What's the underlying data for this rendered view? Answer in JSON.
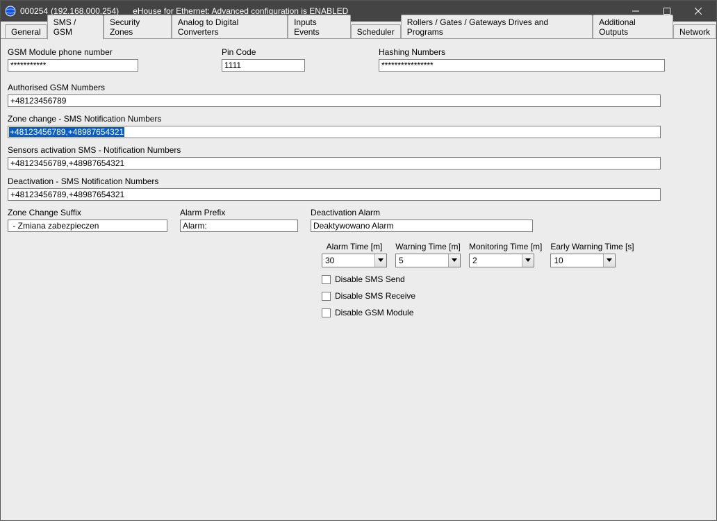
{
  "titlebar": {
    "device_id": "000254",
    "ip": "(192.168.000.254)",
    "app_title": "eHouse for Ethernet: Advanced configuration is ENABLED"
  },
  "tabs": [
    "General",
    "SMS / GSM",
    "Security Zones",
    "Analog to Digital Converters",
    "Inputs Events",
    "Scheduler",
    "Rollers / Gates / Gateways Drives  and Programs",
    "Additional Outputs",
    "Network"
  ],
  "active_tab_index": 1,
  "fields": {
    "gsm_phone": {
      "label": "GSM Module phone number",
      "value": "***********"
    },
    "pin": {
      "label": "Pin Code",
      "value": "1111"
    },
    "hashing": {
      "label": "Hashing Numbers",
      "value": "****************"
    },
    "authorised": {
      "label": "Authorised GSM Numbers",
      "value": "+48123456789"
    },
    "zone_change_nums": {
      "label": "Zone change - SMS Notification Numbers",
      "value": "+48123456789,+48987654321"
    },
    "sensors_nums": {
      "label": "Sensors activation SMS - Notification Numbers",
      "value": "+48123456789,+48987654321"
    },
    "deact_nums": {
      "label": "Deactivation - SMS Notification Numbers",
      "value": "+48123456789,+48987654321"
    },
    "zone_suffix": {
      "label": "Zone Change Suffix",
      "value": " - Zmiana zabezpieczen"
    },
    "alarm_prefix": {
      "label": "Alarm Prefix",
      "value": "Alarm:"
    },
    "deact_alarm": {
      "label": "Deactivation Alarm",
      "value": "Deaktywowano Alarm"
    }
  },
  "dropdowns": {
    "alarm_time": {
      "label": "Alarm Time [m]",
      "value": "30"
    },
    "warning_time": {
      "label": "Warning Time [m]",
      "value": "5"
    },
    "monitoring_time": {
      "label": "Monitoring Time [m]",
      "value": "2"
    },
    "early_warning": {
      "label": "Early Warning Time [s]",
      "value": "10"
    }
  },
  "checkboxes": {
    "disable_send": {
      "label": "Disable SMS Send",
      "checked": false
    },
    "disable_recv": {
      "label": "Disable SMS Receive",
      "checked": false
    },
    "disable_module": {
      "label": "Disable GSM Module",
      "checked": false
    }
  }
}
